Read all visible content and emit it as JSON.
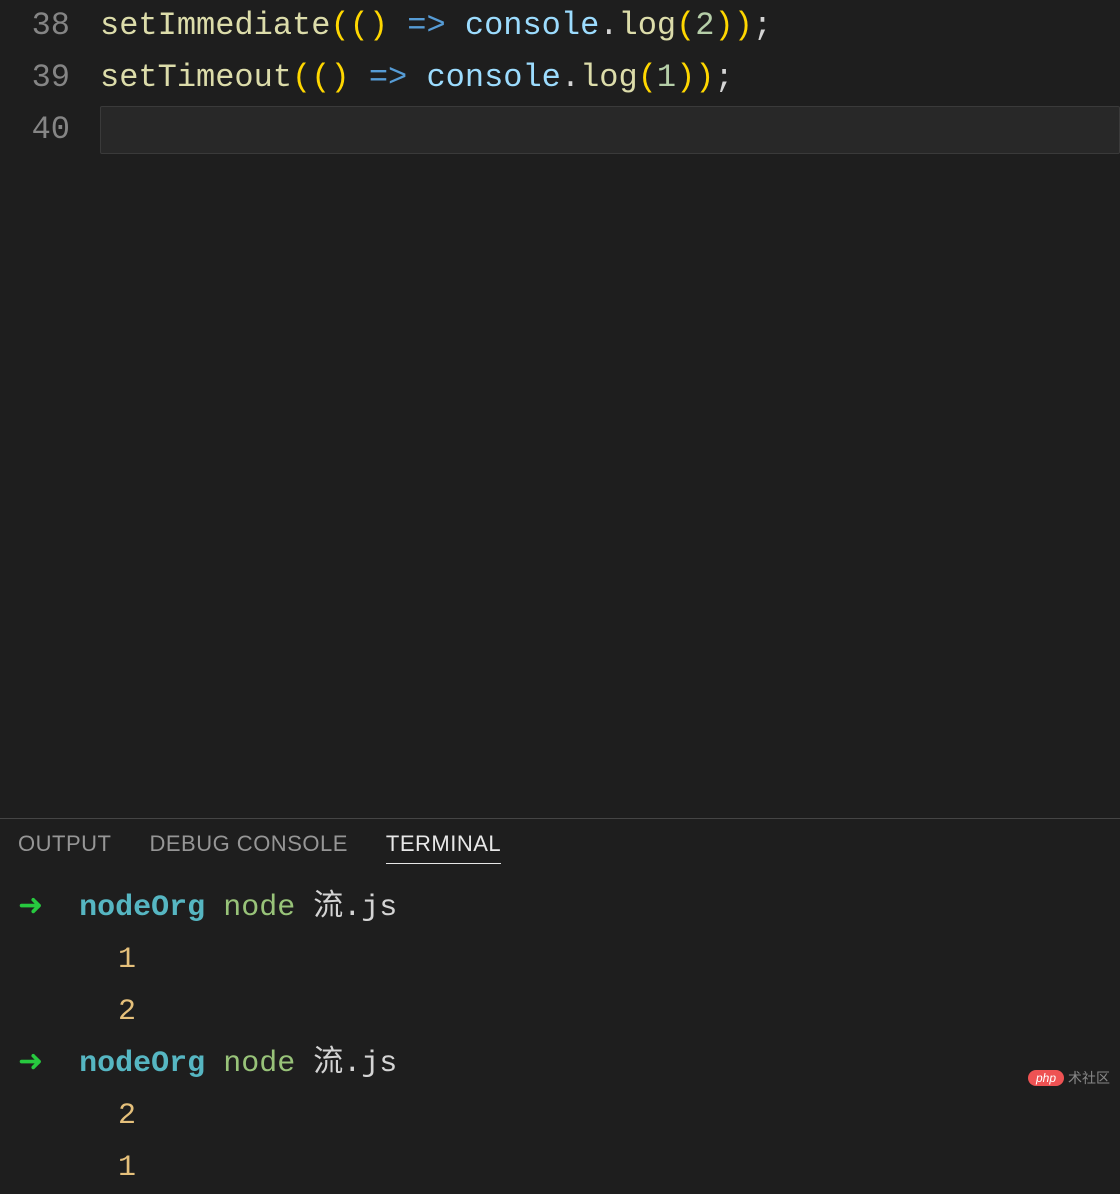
{
  "editor": {
    "lines": [
      {
        "number": "38",
        "tokens": [
          {
            "text": "setImmediate",
            "class": "fn-name"
          },
          {
            "text": "((",
            "class": "paren"
          },
          {
            "text": ") ",
            "class": "paren"
          },
          {
            "text": "=>",
            "class": "arrow"
          },
          {
            "text": " ",
            "class": ""
          },
          {
            "text": "console",
            "class": "obj"
          },
          {
            "text": ".",
            "class": "dot"
          },
          {
            "text": "log",
            "class": "method"
          },
          {
            "text": "(",
            "class": "paren"
          },
          {
            "text": "2",
            "class": "number"
          },
          {
            "text": "))",
            "class": "paren"
          },
          {
            "text": ";",
            "class": "semicolon"
          }
        ]
      },
      {
        "number": "39",
        "tokens": [
          {
            "text": "setTimeout",
            "class": "fn-name"
          },
          {
            "text": "((",
            "class": "paren"
          },
          {
            "text": ") ",
            "class": "paren"
          },
          {
            "text": "=>",
            "class": "arrow"
          },
          {
            "text": " ",
            "class": ""
          },
          {
            "text": "console",
            "class": "obj"
          },
          {
            "text": ".",
            "class": "dot"
          },
          {
            "text": "log",
            "class": "method"
          },
          {
            "text": "(",
            "class": "paren"
          },
          {
            "text": "1",
            "class": "number"
          },
          {
            "text": "))",
            "class": "paren"
          },
          {
            "text": ";",
            "class": "semicolon"
          }
        ]
      },
      {
        "number": "40",
        "tokens": [],
        "current": true
      }
    ]
  },
  "panel": {
    "tabs": [
      {
        "label": "OUTPUT",
        "active": false
      },
      {
        "label": "DEBUG CONSOLE",
        "active": false
      },
      {
        "label": "TERMINAL",
        "active": true
      }
    ],
    "terminal": [
      {
        "type": "prompt",
        "arrow": "➜  ",
        "dir": "nodeOrg",
        "cmd": " node ",
        "arg": "流.js"
      },
      {
        "type": "output",
        "text": "1"
      },
      {
        "type": "output",
        "text": "2"
      },
      {
        "type": "prompt",
        "arrow": "➜  ",
        "dir": "nodeOrg",
        "cmd": " node ",
        "arg": "流.js"
      },
      {
        "type": "output",
        "text": "2"
      },
      {
        "type": "output",
        "text": "1"
      }
    ]
  },
  "watermark": {
    "badge": "php",
    "text": "术社区"
  }
}
